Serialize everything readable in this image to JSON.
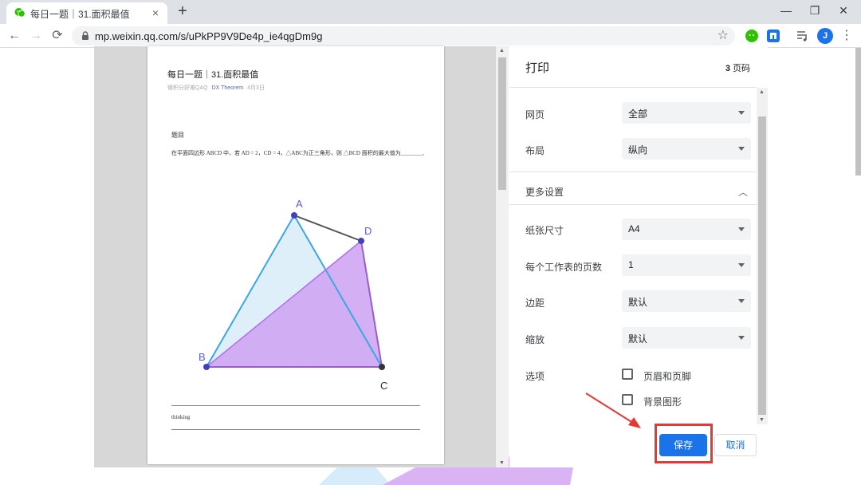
{
  "browser": {
    "tab": {
      "title": "每日一题｜31.面积最值",
      "close": "×"
    },
    "new_tab": "+",
    "window_controls": {
      "minimize": "—",
      "restore": "❐",
      "close": "✕"
    },
    "nav": {
      "back": "←",
      "forward": "→",
      "reload": "⟳"
    },
    "url": "mp.weixin.qq.com/s/uPkPP9V9De4p_ie4qgDm9g",
    "bookmark": "☆",
    "profile_initial": "J",
    "menu": "⋮"
  },
  "preview": {
    "article_title": "每日一题｜31.面积最值",
    "meta_author": "微积分好难QAQ",
    "meta_account": "DX Theorem",
    "meta_date": "4月3日",
    "question_heading": "题目",
    "question_text": "在平面四边形 ABCD 中，若 AD = 2，CD = 4，△ABC为正三角形，则 △BCD 面积的最大值为________.",
    "figure_labels": {
      "A": "A",
      "B": "B",
      "C": "C",
      "D": "D"
    },
    "thinking_label": "thinking"
  },
  "print_panel": {
    "title": "打印",
    "page_count": "3",
    "page_unit": "页码",
    "rows": [
      {
        "label": "网页",
        "value": "全部"
      },
      {
        "label": "布局",
        "value": "纵向"
      }
    ],
    "more_settings": "更多设置",
    "more_rows": [
      {
        "label": "纸张尺寸",
        "value": "A4"
      },
      {
        "label": "每个工作表的页数",
        "value": "1"
      },
      {
        "label": "边距",
        "value": "默认"
      },
      {
        "label": "缩放",
        "value": "默认"
      }
    ],
    "options_label": "选项",
    "options": [
      {
        "label": "页眉和页脚",
        "checked": false
      },
      {
        "label": "背景图形",
        "checked": false
      }
    ],
    "save_button": "保存",
    "cancel_button": "取消"
  },
  "colors": {
    "accent": "#1a73e8",
    "highlight": "#e53935",
    "triangle_abc": "#4fb3e8",
    "triangle_bcd": "#b46ee6",
    "vertex": "#4040c0"
  },
  "icons": {
    "tab_favicon": "wechat-icon",
    "lock": "lock-icon",
    "extensions": [
      "wechat-ext-icon",
      "reader-ext-icon",
      "media-icon"
    ]
  }
}
